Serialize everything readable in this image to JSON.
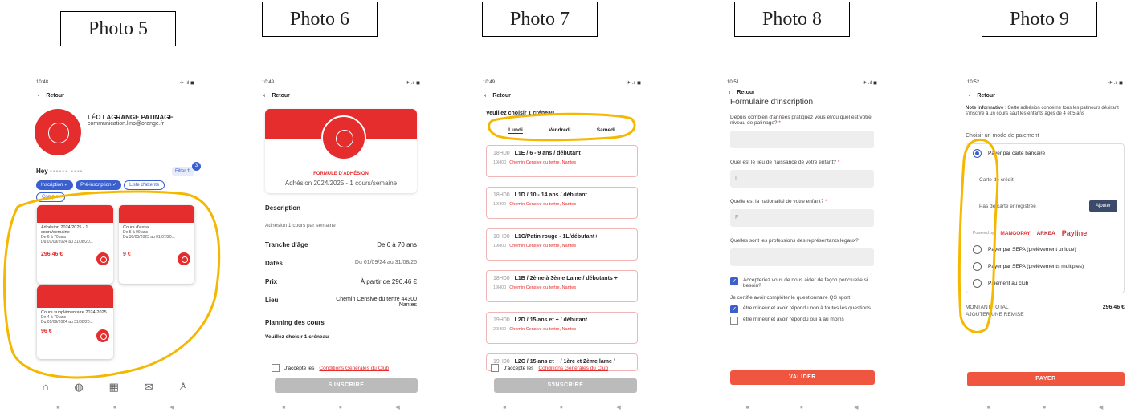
{
  "photos": [
    "Photo 5",
    "Photo 6",
    "Photo 7",
    "Photo 8",
    "Photo 9"
  ],
  "p5": {
    "time": "10:48",
    "icons": "✈ .ıl ◼",
    "back": "Retour",
    "club": "LÉO LAGRANGE PATINAGE",
    "email": "communication.llnp@orange.fr",
    "hey": "Hey",
    "filter": "Filter",
    "filter_count": "3",
    "pills": [
      "Inscription",
      "Pré-inscription",
      "Liste d'attente",
      "Complet"
    ],
    "cards": [
      {
        "title": "Adhésion 2024/2025 - 1 cours/semaine",
        "age": "De 6 à 70 ans",
        "date": "Du 01/09/2024 au 31/08/20...",
        "price": "296.46 €"
      },
      {
        "title": "Cours d'essai",
        "age": "De 5 à 99 ans",
        "date": "Du 30/05/2023 au 01/07/20...",
        "price": "9 €"
      },
      {
        "title": "Cours supplémentaire 2024-2025",
        "age": "De 4 à 70 ans",
        "date": "Du 01/09/2024 au 31/08/20...",
        "price": "96 €"
      }
    ]
  },
  "p6": {
    "time": "10:49",
    "back": "Retour",
    "formule": "FORMULE D'ADHÉSION",
    "title": "Adhésion 2024/2025 - 1 cours/semaine",
    "desc_h": "Description",
    "desc": "Adhésion 1 cours par semaine",
    "rows": [
      {
        "k": "Tranche d'âge",
        "v": "De 6 à 70 ans"
      },
      {
        "k": "Dates",
        "v": "Du 01/09/24 au 31/08/25"
      },
      {
        "k": "Prix",
        "v": "À partir de 296.46 €"
      },
      {
        "k": "Lieu",
        "v": "Chemin Censive du tertre 44300 Nantes"
      }
    ],
    "planning": "Planning des cours",
    "choose": "Veuillez choisir 1 créneau",
    "accept": "J'accepte les",
    "cgu": "Conditions Générales du Club",
    "btn": "S'INSCRIRE"
  },
  "p7": {
    "time": "10:49",
    "back": "Retour",
    "choose": "Veuillez choisir 1 créneau",
    "days": [
      "Lundi",
      "Vendredi",
      "Samedi"
    ],
    "slots": [
      {
        "t": "L1E / 6 - 9 ans / débutant",
        "h1": "18H00",
        "h2": "19H00"
      },
      {
        "t": "L1D / 10 - 14 ans / débutant",
        "h1": "18H00",
        "h2": "19H00"
      },
      {
        "t": "L1C/Patin rouge - 1L/débutant+",
        "h1": "18H00",
        "h2": "19H00"
      },
      {
        "t": "L1B / 2ème à 3ème Lame / débutants +",
        "h1": "18H00",
        "h2": "19H00"
      },
      {
        "t": "L2D / 15 ans et + / débutant",
        "h1": "19H00",
        "h2": "20H00"
      },
      {
        "t": "L2C / 15 ans et + / 1ère et 2ème lame / débutan...",
        "h1": "19H00",
        "h2": ""
      }
    ],
    "loc": "Chemin Censive du tertre, Nantes",
    "accept": "J'accepte les",
    "cgu": "Conditions Générales du Club",
    "btn": "S'INSCRIRE"
  },
  "p8": {
    "time": "10:51",
    "back": "Retour",
    "title": "Formulaire d'inscription",
    "q1": "Depuis combien d'années pratiquez vous et/ou quel est votre niveau de patinage?",
    "q2": "Quel est le lieu de naissance de votre enfant?",
    "v2": "I",
    "q3": "Quelle est la nationalité de votre enfant?",
    "v3": "F",
    "q4": "Quelles sont les professions des représentants légaux?",
    "c1": "Accepteriez vous de nous aider de façon ponctuelle si besoin?",
    "c2": "Je certifie avoir compléter le questionnaire QS sport",
    "c3": "être mineur et avoir répondu non à toutes les questions",
    "c4": "être mineur et avoir répondu oui à au moins",
    "btn": "VALIDER"
  },
  "p9": {
    "time": "10:52",
    "back": "Retour",
    "note_b": "Note informative",
    "note": ": Cette adhésion concerne tous les patineurs désirant s'inscrire à un cours sauf les enfants âgés de 4 et 5 ans",
    "choose": "Choisir un mode de paiement",
    "opt1": "Payer par carte bancaire",
    "credit": "Carte de crédit",
    "saved": "Pas de carte enregistrée",
    "add": "Ajouter",
    "powered": "Powered by",
    "mango": "MANGOPAY",
    "arkea": "ARKEA",
    "payline": "Payline",
    "opt2": "Payer par SEPA (prélèvement unique)",
    "opt3": "Payer par SEPA (prélèvements multiples)",
    "opt4": "Paiement au club",
    "total_l": "MONTANT TOTAL",
    "total": "296.46 €",
    "remise": "AJOUTER UNE REMISE",
    "btn": "PAYER"
  },
  "colors": {
    "red": "#e52d2d",
    "highlight": "#f5b800",
    "blue": "#3a5fcf"
  }
}
